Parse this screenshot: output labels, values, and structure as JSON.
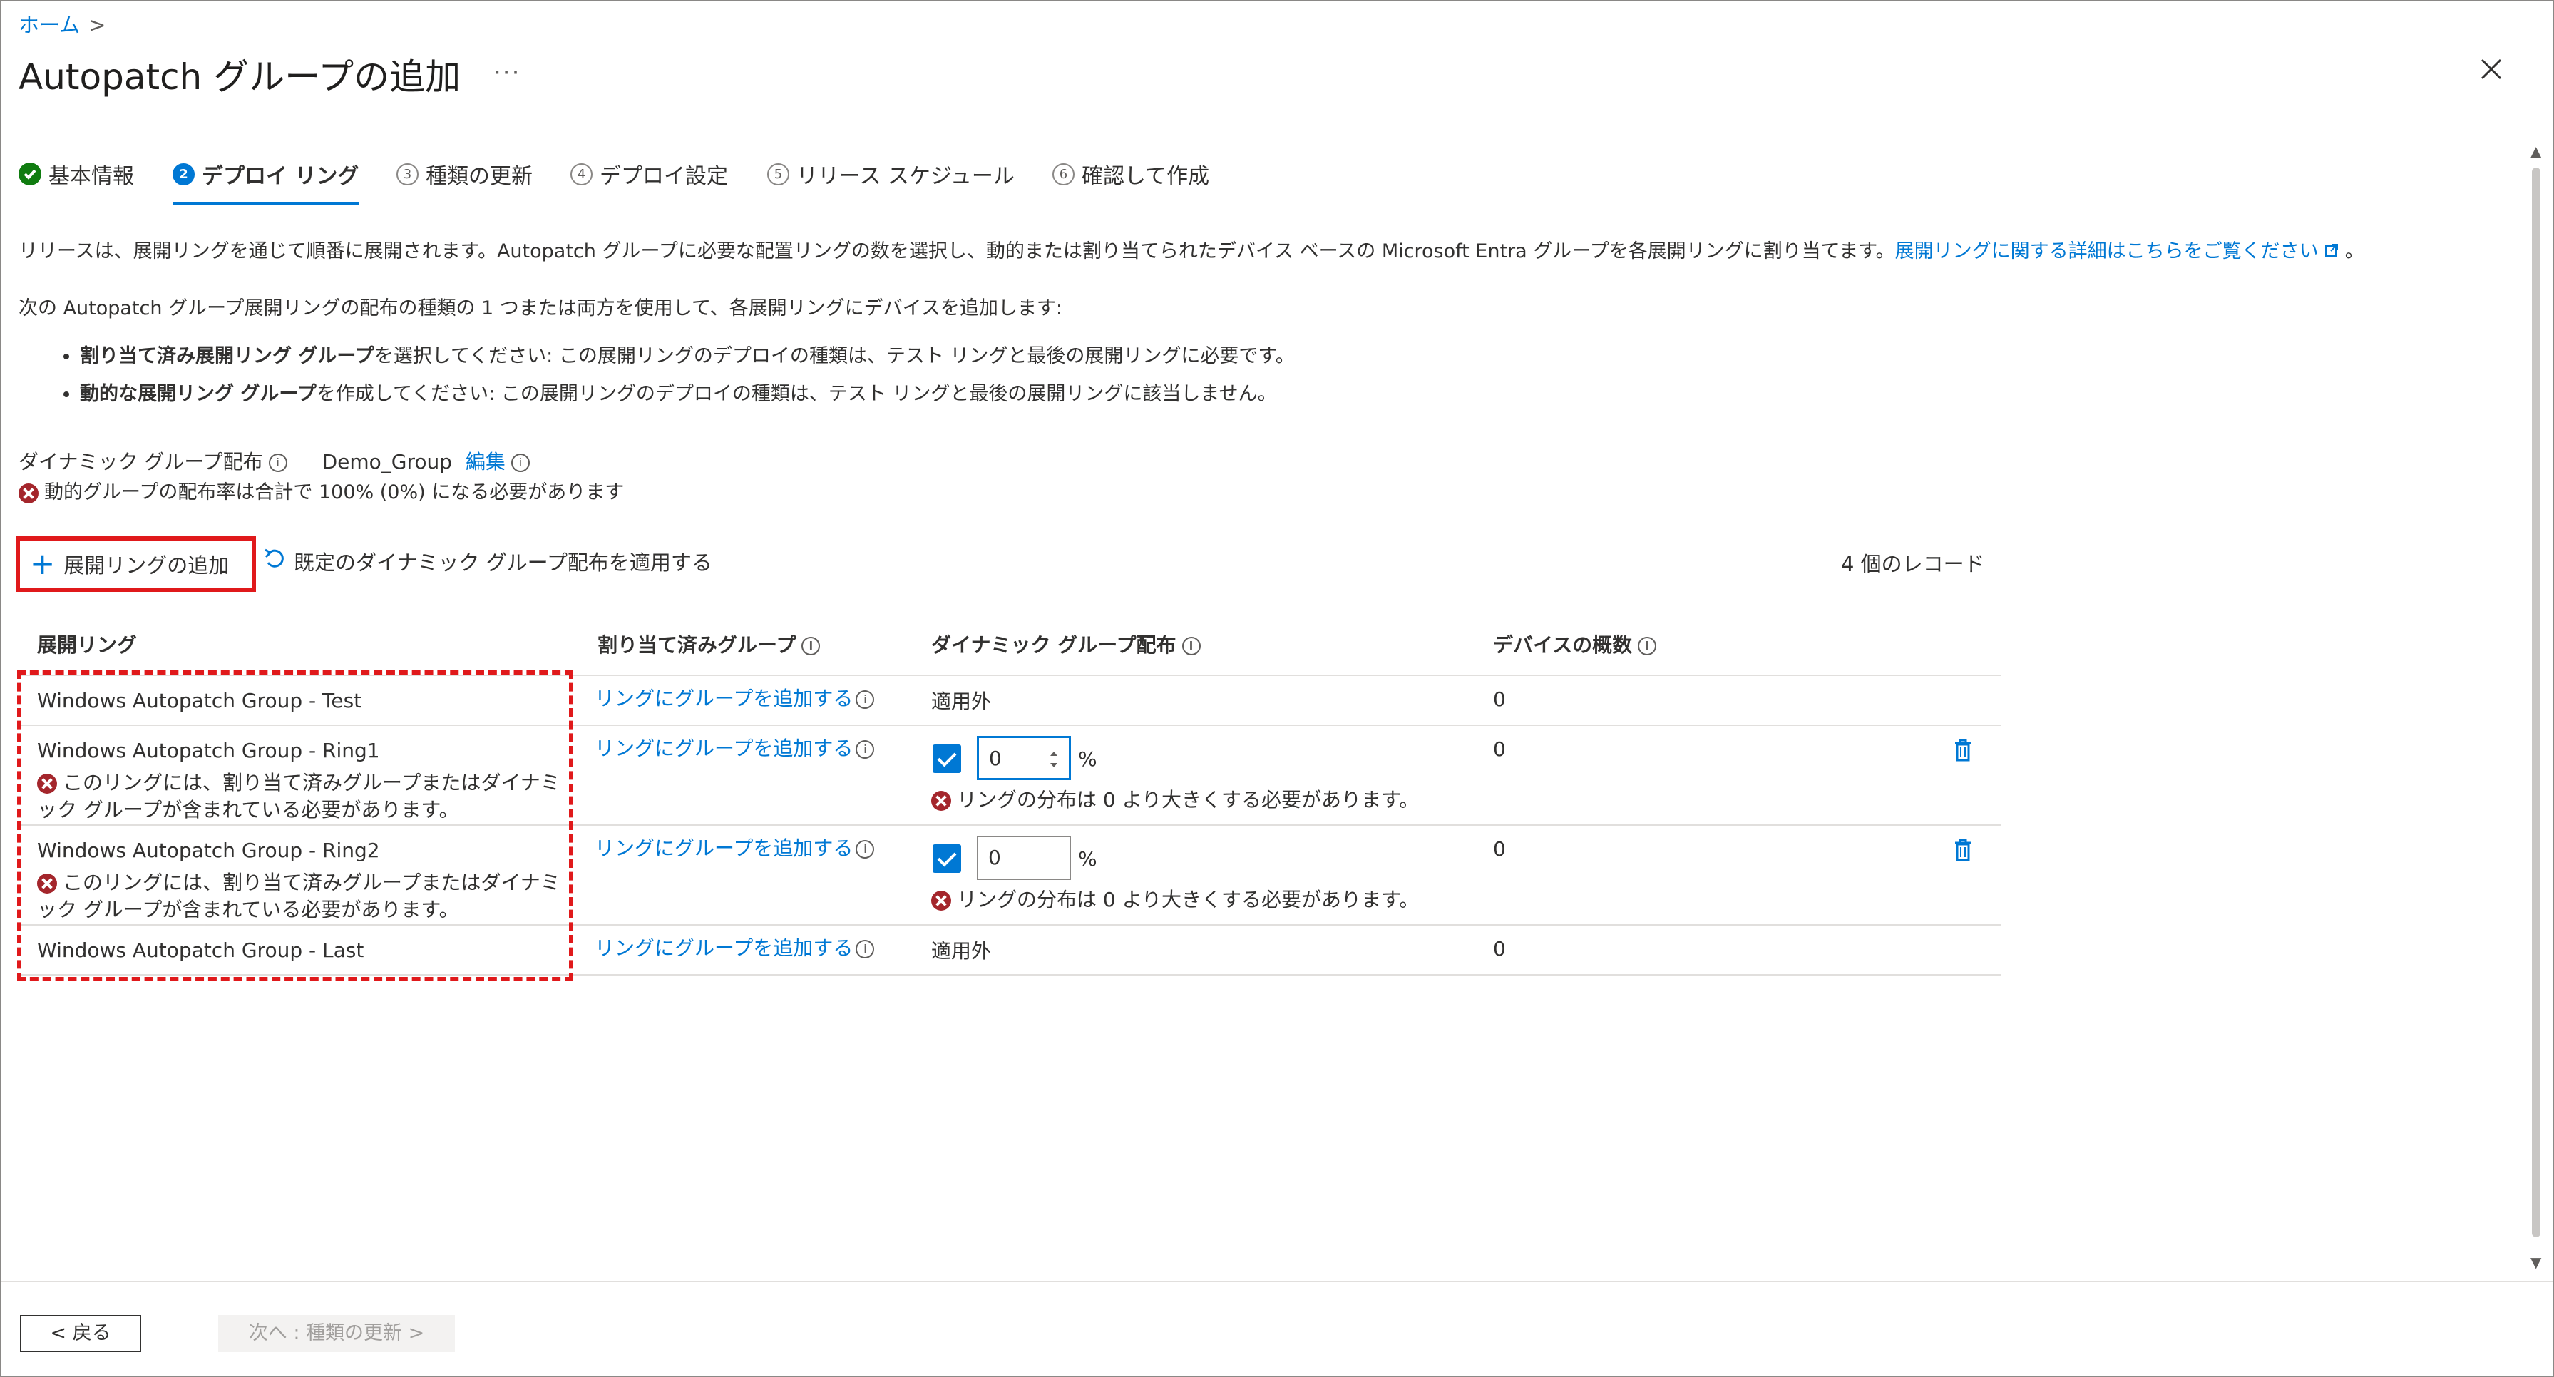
{
  "breadcrumb": {
    "home": "ホーム",
    "sep": ">"
  },
  "title": "Autopatch グループの追加",
  "more": "···",
  "steps": [
    {
      "label": "基本情報",
      "num": ""
    },
    {
      "label": "デプロイ リング",
      "num": "2"
    },
    {
      "label": "種類の更新",
      "num": "3"
    },
    {
      "label": "デプロイ設定",
      "num": "4"
    },
    {
      "label": "リリース スケジュール",
      "num": "5"
    },
    {
      "label": "確認して作成",
      "num": "6"
    }
  ],
  "intro": {
    "text": "リリースは、展開リングを通じて順番に展開されます。Autopatch グループに必要な配置リングの数を選択し、動的または割り当てられたデバイス ベースの Microsoft Entra グループを各展開リングに割り当てます。",
    "link": "展開リングに関する詳細はこちらをご覧ください",
    "end": "。"
  },
  "subtitle": "次の Autopatch グループ展開リングの配布の種類の 1 つまたは両方を使用して、各展開リングにデバイスを追加します:",
  "bullets": [
    {
      "bold": "割り当て済み展開リング グループ",
      "rest": "を選択してください: この展開リングのデプロイの種類は、テスト リングと最後の展開リングに必要です。"
    },
    {
      "bold": "動的な展開リング グループ",
      "rest": "を作成してください: この展開リングのデプロイの種類は、テスト リングと最後の展開リングに該当しません。"
    }
  ],
  "dynamic": {
    "label": "ダイナミック グループ配布",
    "value": "Demo_Group",
    "edit": "編集",
    "error": "動的グループの配布率は合計で 100% (0%) になる必要があります"
  },
  "toolbar": {
    "add": "展開リングの追加",
    "reset": "既定のダイナミック グループ配布を適用する",
    "records": "4 個のレコード"
  },
  "table": {
    "headers": [
      "展開リング",
      "割り当て済みグループ",
      "ダイナミック グループ配布",
      "デバイスの概数"
    ],
    "add_group_link": "リングにグループを追加する",
    "ring_error_line1": "このリングには、割り当て済みグループまたはダイナミ",
    "ring_error_line2": "ック グループが含まれている必要があります。",
    "dist_error": "リングの分布は 0 より大きくする必要があります。",
    "pct": "%",
    "rows": [
      {
        "name": "Windows Autopatch Group - Test",
        "dist": "適用外",
        "devices": "0"
      },
      {
        "name": "Windows Autopatch Group - Ring1",
        "value": "0",
        "devices": "0"
      },
      {
        "name": "Windows Autopatch Group - Ring2",
        "value": "0",
        "devices": "0"
      },
      {
        "name": "Windows Autopatch Group - Last",
        "dist": "適用外",
        "devices": "0"
      }
    ]
  },
  "footer": {
    "back": "< 戻る",
    "next": "次へ : 種類の更新 >"
  },
  "colors": {
    "accent": "#0078d4",
    "error": "#a4262c",
    "highlight": "#e0191b",
    "success": "#107c10"
  }
}
